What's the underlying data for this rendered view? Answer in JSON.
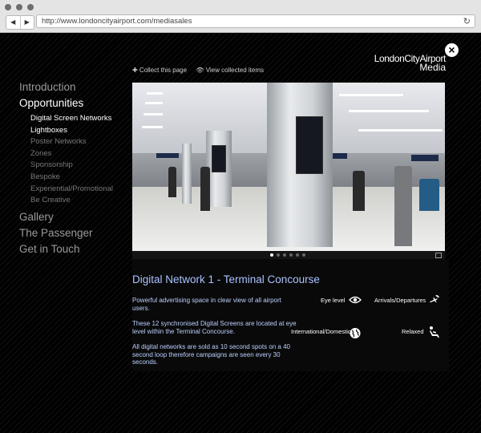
{
  "browser": {
    "url": "http://www.londoncityairport.com/mediasales",
    "back_glyph": "◀",
    "forward_glyph": "▶",
    "reload_glyph": "↻"
  },
  "logo": {
    "line1": "LondonCityAirport",
    "line2": "Media"
  },
  "close_glyph": "×",
  "actions": {
    "collect": "✚ Collect this page",
    "view": "👁 View collected items"
  },
  "nav": {
    "top_items": [
      "Introduction",
      "Opportunities",
      "Gallery",
      "The Passenger",
      "Get in Touch"
    ],
    "sub_items": [
      "Digital Screen Networks",
      "Lightboxes",
      "Poster Networks",
      "Zones",
      "Sponsorship",
      "Bespoke",
      "Experiential/Promotional",
      "Be Creative"
    ],
    "active_top": "Opportunities",
    "active_subs": [
      "Digital Screen Networks",
      "Lightboxes"
    ]
  },
  "slideshow": {
    "count": 6,
    "active_index": 0
  },
  "content": {
    "title": "Digital Network 1 - Terminal Concourse",
    "paragraphs": [
      "Powerful advertising space in clear view of all airport users.",
      "These 12 synchronised Digital Screens are located at eye level within the Terminal Concourse.",
      "All digital networks are sold as 10 second spots on a 40 second loop therefore campaigns are seen every 30 seconds."
    ]
  },
  "features": [
    {
      "label": "Eye level",
      "icon": "eye-icon"
    },
    {
      "label": "Arrivals/Departures",
      "icon": "planes-icon"
    },
    {
      "label": "International/Domestic",
      "icon": "globe-icon"
    },
    {
      "label": "Relaxed",
      "icon": "reclining-seat-icon"
    }
  ],
  "colors": {
    "accent_text": "#a9c2ff",
    "body_text": "#bcd0ff",
    "nav_inactive": "#9a9a9a",
    "nav_sub_inactive": "#777777"
  }
}
